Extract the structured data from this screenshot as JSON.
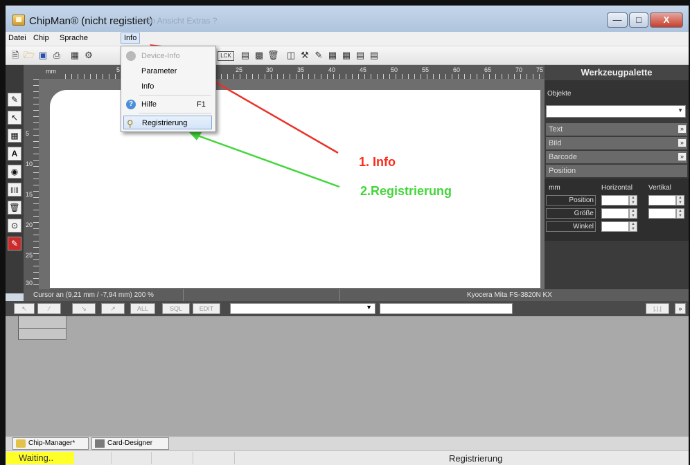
{
  "window": {
    "title": "ChipMan® (nicht registiert)",
    "title_ghost": "ion Ansicht Extras ?",
    "min_glyph": "—",
    "max_glyph": "□",
    "close_glyph": "X"
  },
  "menubar": [
    "Datei",
    "Chip",
    "Sprache",
    "Info"
  ],
  "dropdown": {
    "items": [
      {
        "label": "Device-Info",
        "shortcut": "",
        "disabled": true,
        "icon": "chip-icon"
      },
      {
        "label": "Parameter",
        "shortcut": "",
        "disabled": false,
        "icon": ""
      },
      {
        "label": "Info",
        "shortcut": "",
        "disabled": false,
        "icon": ""
      },
      {
        "label": "Hilfe",
        "shortcut": "F1",
        "disabled": false,
        "icon": "help-icon"
      },
      {
        "label": "Registrierung",
        "shortcut": "",
        "disabled": false,
        "icon": "key-icon",
        "highlighted": true
      }
    ]
  },
  "toolbar": {
    "icons": [
      "new-icon",
      "open-icon",
      "save-icon",
      "print-icon",
      "properties-icon",
      "settings-icon",
      "chip-icon",
      "lck-icon",
      "card-icon",
      "floppy-icon",
      "delete-icon",
      "copy-icon",
      "tool-icon",
      "encode-icon",
      "card-a-icon",
      "card-b-icon",
      "stack-icon",
      "stack2-icon"
    ],
    "lck_label": "LCK"
  },
  "ruler": {
    "unit": "mm",
    "top_labels": [
      "5",
      "25",
      "30",
      "35",
      "40",
      "45",
      "50",
      "55",
      "60",
      "65",
      "70",
      "75"
    ],
    "left_labels": [
      "5",
      "10",
      "15",
      "20",
      "25",
      "30"
    ]
  },
  "annotations": {
    "step1": "1. Info",
    "step2": "2.Registrierung",
    "arrow1_color": "#e8332a",
    "arrow2_color": "#43d63a"
  },
  "palette": {
    "title": "Werkzeugpalette",
    "objects_label": "Objekte",
    "sections": [
      "Text",
      "Bild",
      "Barcode",
      "Position"
    ],
    "position": {
      "unit": "mm",
      "horizontal": "Horizontal",
      "vertical": "Vertikal",
      "rows": [
        "Position",
        "Größe",
        "Winkel"
      ]
    }
  },
  "status": {
    "cursor": "Cursor an (9,21 mm / -7,94 mm) 200 %",
    "printer": "Kyocera Mita FS-3820N KX"
  },
  "bottom_toolbar": {
    "buttons": [
      "↖",
      "∕",
      "↘",
      "↗",
      "ALL",
      "SQL",
      "EDIT"
    ],
    "right_btn": "|.|.|"
  },
  "tabs": [
    "Chip-Manager*",
    "Card-Designer"
  ],
  "statusbar": {
    "waiting": "Waiting..",
    "message": "Registrierung"
  },
  "colors": {
    "accent": "#ffff2a",
    "palette_bg": "#3b3b3b"
  }
}
